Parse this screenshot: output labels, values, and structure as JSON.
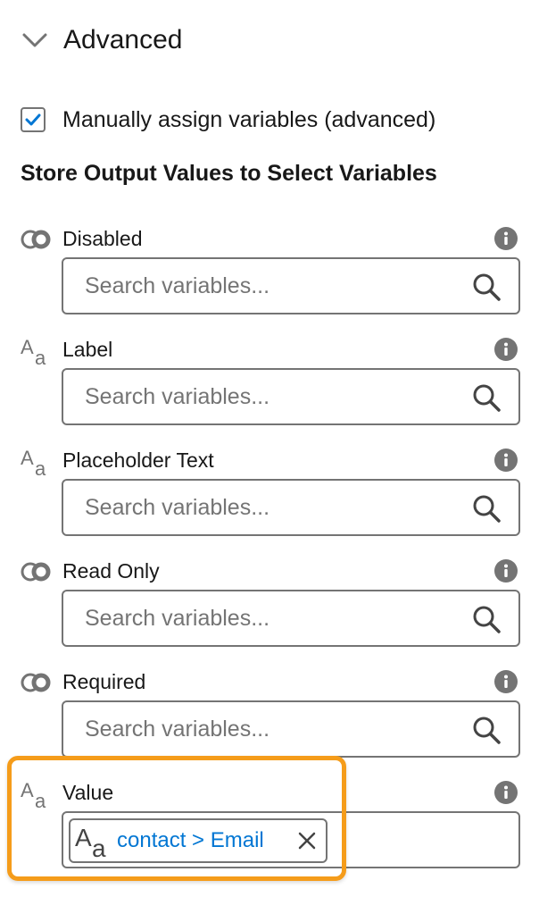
{
  "section": {
    "title": "Advanced",
    "expanded": true
  },
  "manual_assign": {
    "label": "Manually assign variables (advanced)",
    "checked": true
  },
  "subheading": "Store Output Values to Select Variables",
  "fields": [
    {
      "label": "Disabled",
      "type_icon": "boolean-icon",
      "placeholder": "Search variables..."
    },
    {
      "label": "Label",
      "type_icon": "text-type-icon",
      "placeholder": "Search variables..."
    },
    {
      "label": "Placeholder Text",
      "type_icon": "text-type-icon",
      "placeholder": "Search variables..."
    },
    {
      "label": "Read Only",
      "type_icon": "boolean-icon",
      "placeholder": "Search variables..."
    },
    {
      "label": "Required",
      "type_icon": "boolean-icon",
      "placeholder": "Search variables..."
    }
  ],
  "value_field": {
    "label": "Value",
    "type_icon": "text-type-icon",
    "pill_text": "contact > Email"
  },
  "colors": {
    "accent": "#0176d3",
    "highlight": "#f59c1a",
    "icon_gray": "#747474"
  }
}
